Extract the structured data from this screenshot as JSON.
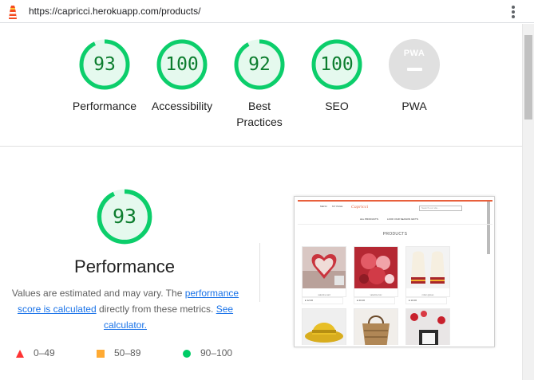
{
  "browser": {
    "url": "https://capricci.herokuapp.com/products/"
  },
  "colors": {
    "pass": "#0cce6b",
    "pass_text": "#0c7d2e",
    "pass_fill": "#e5f9ee",
    "average": "#ffaa33",
    "fail": "#ff3333",
    "pwa_gray": "#e0e0e0",
    "link": "#1a73e8"
  },
  "summary": {
    "categories": [
      {
        "label": "Performance",
        "score": 93
      },
      {
        "label": "Accessibility",
        "score": 100
      },
      {
        "label": "Best\nPractices",
        "score": 92
      },
      {
        "label": "SEO",
        "score": 100
      },
      {
        "label": "PWA",
        "badge": "PWA",
        "icon": "pwa-badge-icon"
      }
    ]
  },
  "performance": {
    "score": 93,
    "title": "Performance",
    "desc_prefix": "Values are estimated and may vary. The ",
    "link_score": "performance score is calculated",
    "desc_middle": " directly from these metrics. ",
    "link_calculator": "See calculator.",
    "legend": [
      {
        "shape": "triangle",
        "range": "0–49"
      },
      {
        "shape": "square",
        "range": "50–89"
      },
      {
        "shape": "circle",
        "range": "90–100"
      }
    ]
  },
  "thumbnail": {
    "logo": "Capricci",
    "search_placeholder": "Search our site...",
    "nav_icons": [
      "MENU",
      "MY PAGE"
    ],
    "menu": [
      "ALL PRODUCTS",
      "LOOK OUR SEASON GIFTS"
    ],
    "heading": "PRODUCTS",
    "products": [
      {
        "caption": "valentine card",
        "price": "£ 12.00"
      },
      {
        "caption": "valentine box",
        "price": "£ 20.00"
      },
      {
        "caption": "mitten gloves",
        "price": "£ 10.00"
      },
      {
        "caption": "",
        "price": ""
      },
      {
        "caption": "",
        "price": ""
      },
      {
        "caption": "",
        "price": ""
      }
    ]
  }
}
